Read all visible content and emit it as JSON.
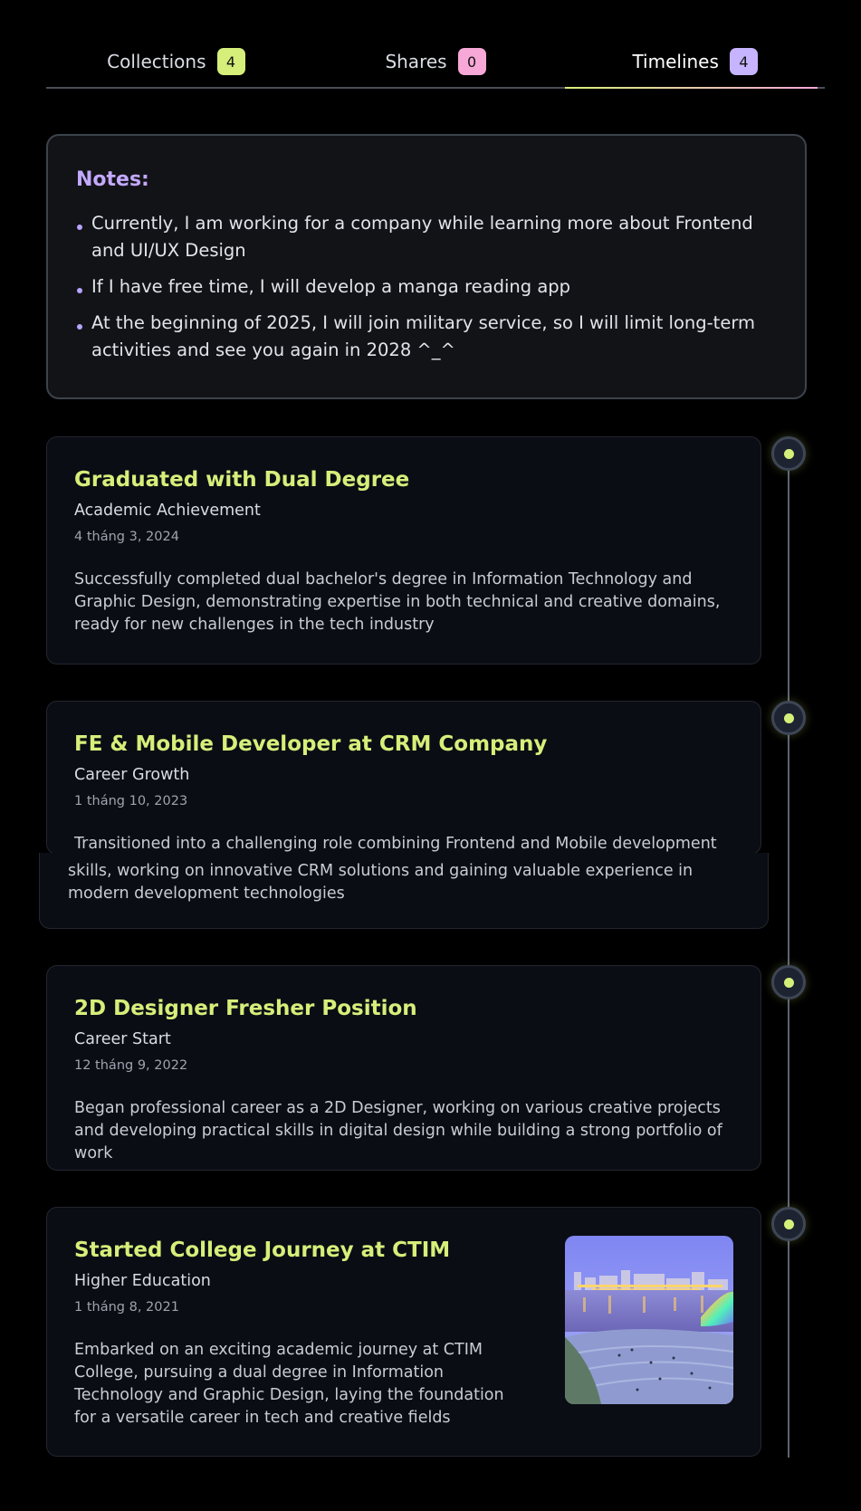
{
  "tabs": [
    {
      "label": "Collections",
      "count": "4",
      "badge_color": "#d5ef7a"
    },
    {
      "label": "Shares",
      "count": "0",
      "badge_color": "#f7a8d6"
    },
    {
      "label": "Timelines",
      "count": "4",
      "badge_color": "#c6b4ff",
      "active": true
    }
  ],
  "notes": {
    "title": "Notes:",
    "items": [
      "Currently, I am working for a company while learning more about Frontend and UI/UX Design",
      "If I have free time, I will develop a manga reading app",
      "At the beginning of 2025, I will join military service, so I will limit long-term activities and see you again in 2028 ^_^"
    ]
  },
  "timeline": [
    {
      "title": "Graduated with Dual Degree",
      "category": "Academic Achievement",
      "date": "4 tháng 3, 2024",
      "description": "Successfully completed dual bachelor's degree in Information Technology and Graphic Design, demonstrating expertise in both technical and creative domains, ready for new challenges in the tech industry"
    },
    {
      "title": "FE & Mobile Developer at CRM Company",
      "category": "Career Growth",
      "date": "1 tháng 10, 2023",
      "description_line1": "Transitioned into a challenging role combining Frontend and Mobile development",
      "description_rest": "skills, working on innovative CRM solutions and gaining valuable experience in modern development technologies"
    },
    {
      "title": "2D Designer Fresher Position",
      "category": "Career Start",
      "date": "12 tháng 9, 2022",
      "description": "Began professional career as a 2D Designer, working on various creative projects and developing practical skills in digital design while building a strong portfolio of work"
    },
    {
      "title": "Started College Journey at CTIM",
      "category": "Higher Education",
      "date": "1 tháng 8, 2021",
      "description": "Embarked on an exciting academic journey at CTIM College, pursuing a dual degree in Information Technology and Graphic Design, laying the foundation for a versatile career in tech and creative fields",
      "image": "city-riverside-photo"
    }
  ],
  "colors": {
    "accent_green": "#d5ef7a",
    "accent_purple": "#c3a9ff",
    "accent_pink": "#f7a8d6",
    "card_bg": "#0b0d14"
  }
}
